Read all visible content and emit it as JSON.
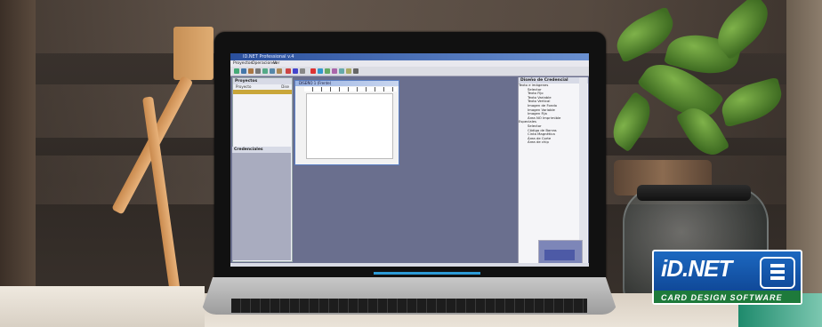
{
  "app": {
    "title": "ID.NET Professional v.4",
    "menu": [
      "Proyectos",
      "Operaciones",
      "Ver"
    ],
    "left_panel": {
      "title": "Proyectos",
      "columns": [
        "Proyecto",
        "Dise"
      ],
      "bottom_title": "Credenciales"
    },
    "design_window": {
      "title": "DISEÑO 1 (Frente)"
    },
    "right_panel": {
      "title": "Diseño de Credencial",
      "tree": [
        {
          "label": "Texto e imágenes",
          "level": 0
        },
        {
          "label": "Selector",
          "level": 1
        },
        {
          "label": "Texto Fijo",
          "level": 1
        },
        {
          "label": "Texto Variable",
          "level": 1
        },
        {
          "label": "Texto Vertical",
          "level": 1
        },
        {
          "label": "Imagen de Fondo",
          "level": 1
        },
        {
          "label": "Imagen Variable",
          "level": 1
        },
        {
          "label": "Imagen Fija",
          "level": 1
        },
        {
          "label": "Área NO Imprimible",
          "level": 1
        },
        {
          "label": "Especiales",
          "level": 0
        },
        {
          "label": "Selector",
          "level": 1
        },
        {
          "label": "Código de Barras",
          "level": 1
        },
        {
          "label": "Cinta Magnética",
          "level": 1
        },
        {
          "label": "Área de Corte",
          "level": 1
        },
        {
          "label": "Área de chip",
          "level": 1
        }
      ]
    }
  },
  "logo": {
    "main": "iD.NET",
    "tagline": "CARD DESIGN SOFTWARE"
  },
  "colors": {
    "logo_blue": "#1c68c0",
    "logo_green": "#1e7a3b",
    "titlebar": "#2a4f9c",
    "screen_bg": "#6a6f8e"
  },
  "icons": [
    "chip-card-icon"
  ]
}
